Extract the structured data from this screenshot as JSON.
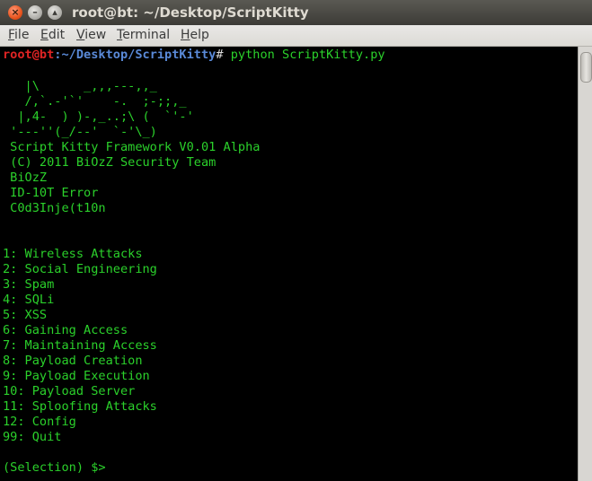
{
  "window": {
    "title": "root@bt: ~/Desktop/ScriptKitty"
  },
  "menu": {
    "file": "File",
    "edit": "Edit",
    "view": "View",
    "terminal": "Terminal",
    "help": "Help"
  },
  "icons": {
    "close": "close-icon",
    "minimize": "minimize-icon",
    "maximize": "maximize-icon"
  },
  "colors": {
    "text_green": "#2bd12b",
    "prompt_red": "#e02424",
    "prompt_blue": "#5a8ad8"
  },
  "terminal": {
    "prompt_user": "root@bt",
    "prompt_path": ":~/Desktop/ScriptKitty",
    "prompt_symbol": "#",
    "command": " python ScriptKitty.py",
    "banner": [
      "   |\\      _,,,---,,_",
      "   /,`.-'`'    -.  ;-;;,_",
      "  |,4-  ) )-,_..;\\ (  `'-'",
      " '---''(_/--'  `-'\\_)",
      " Script Kitty Framework V0.01 Alpha",
      " (C) 2011 BiOzZ Security Team",
      " BiOzZ",
      " ID-10T Error",
      " C0d3Inje(t10n"
    ],
    "menu_options": [
      "1: Wireless Attacks",
      "2: Social Engineering",
      "3: Spam",
      "4: SQLi",
      "5: XSS",
      "6: Gaining Access",
      "7: Maintaining Access",
      "8: Payload Creation",
      "9: Payload Execution",
      "10: Payload Server",
      "11: Sploofing Attacks",
      "12: Config",
      "99: Quit"
    ],
    "input_prompt": "(Selection) $>"
  }
}
